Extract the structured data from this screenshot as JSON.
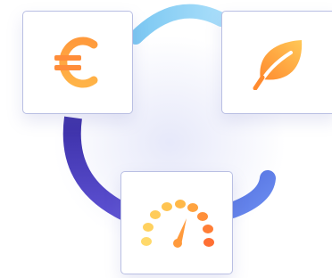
{
  "graphic": {
    "cards": [
      {
        "id": "euro",
        "icon": "euro-icon"
      },
      {
        "id": "leaf",
        "icon": "leaf-icon"
      },
      {
        "id": "gauge",
        "icon": "speedometer-icon"
      }
    ]
  },
  "colors": {
    "ring_top": "#8fd3f4",
    "ring_left": "#4a3fb8",
    "ring_right": "#5d7ae0",
    "icon_orange_light": "#ffcf5a",
    "icon_orange_dark": "#ff7a2e",
    "card_border": "#b9bfe3"
  }
}
